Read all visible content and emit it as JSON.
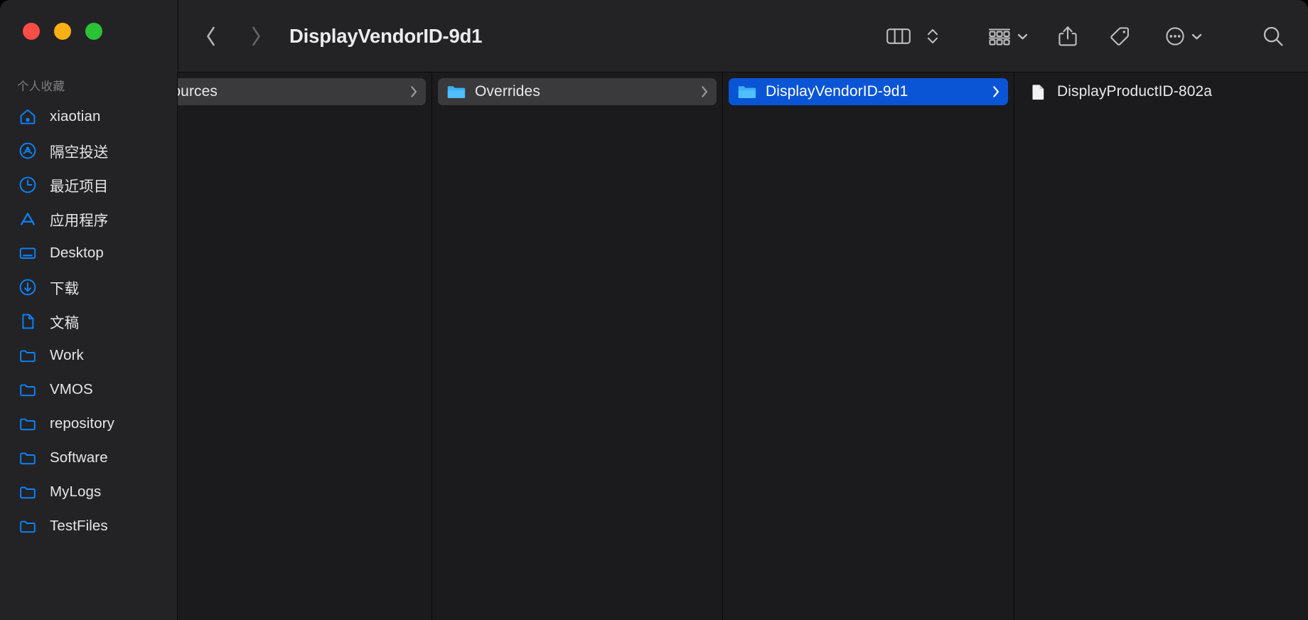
{
  "window": {
    "traffic_lights": [
      {
        "name": "close",
        "color": "#f94e46",
        "label": "Close"
      },
      {
        "name": "minimize",
        "color": "#fbb016",
        "label": "Minimize"
      },
      {
        "name": "zoom",
        "color": "#2cc236",
        "label": "Zoom"
      }
    ]
  },
  "toolbar": {
    "back_label": "Back",
    "forward_label": "Forward",
    "back_enabled": true,
    "forward_enabled": false,
    "title": "DisplayVendorID-9d1",
    "view_mode_label": "Column View",
    "view_stepper_label": "View Options",
    "group_label": "Group",
    "share_label": "Share",
    "tag_label": "Tags",
    "more_label": "More",
    "search_label": "Search"
  },
  "sidebar": {
    "section_title": "个人收藏",
    "items": [
      {
        "label": "xiaotian",
        "icon": "home-icon"
      },
      {
        "label": "隔空投送",
        "icon": "airdrop-icon"
      },
      {
        "label": "最近项目",
        "icon": "clock-icon"
      },
      {
        "label": "应用程序",
        "icon": "applications-icon"
      },
      {
        "label": "Desktop",
        "icon": "desktop-icon"
      },
      {
        "label": "下载",
        "icon": "downloads-icon"
      },
      {
        "label": "文稿",
        "icon": "document-icon"
      },
      {
        "label": "Work",
        "icon": "folder-icon"
      },
      {
        "label": "VMOS",
        "icon": "folder-icon"
      },
      {
        "label": "repository",
        "icon": "folder-icon"
      },
      {
        "label": "Software",
        "icon": "folder-icon"
      },
      {
        "label": "MyLogs",
        "icon": "folder-icon"
      },
      {
        "label": "TestFiles",
        "icon": "folder-icon"
      }
    ]
  },
  "columns": [
    {
      "name": "column-resources",
      "rows": [
        {
          "label": "esources",
          "type": "folder",
          "state": "highlighted",
          "chevron": true,
          "icon_hidden": true
        }
      ]
    },
    {
      "name": "column-overrides",
      "rows": [
        {
          "label": "Overrides",
          "type": "folder",
          "state": "highlighted",
          "chevron": true,
          "icon_hidden": false
        }
      ]
    },
    {
      "name": "column-displayvendorid",
      "rows": [
        {
          "label": "DisplayVendorID-9d1",
          "type": "folder",
          "state": "selected",
          "chevron": true,
          "icon_hidden": false
        }
      ]
    },
    {
      "name": "column-displayproductid",
      "rows": [
        {
          "label": "DisplayProductID-802a",
          "type": "file",
          "state": "plain",
          "chevron": false,
          "icon_hidden": false
        }
      ]
    }
  ],
  "colors": {
    "selection_blue": "#0a55d6",
    "accent_blue": "#0a84ff",
    "toolbar_bg": "#232325",
    "content_bg": "#1b1b1d",
    "row_highlight": "#3a3a3c"
  }
}
